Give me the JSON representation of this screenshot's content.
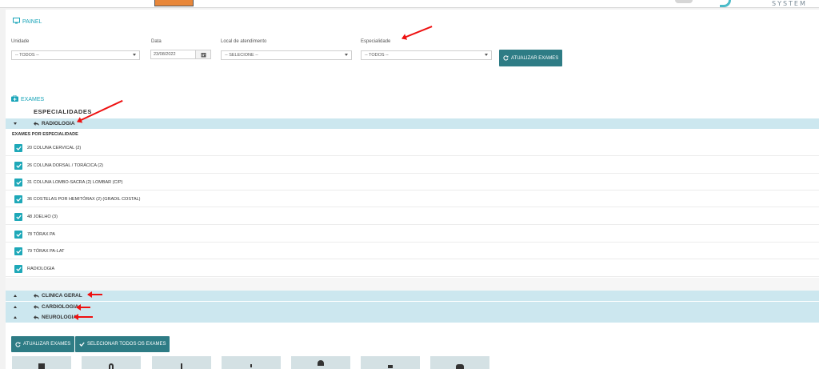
{
  "header": {
    "logo_text": "SYSTEM"
  },
  "painel": {
    "title": "PAINEL",
    "unidade_label": "Unidade",
    "unidade_value": "-- TODOS --",
    "data_label": "Data",
    "data_value": "23/08/2022",
    "local_label": "Local de atendimento",
    "local_value": "-- SELECIONE --",
    "especialidade_label": "Especialidade",
    "especialidade_value": "-- TODOS --",
    "update_button": "ATUALIZAR EXAMES"
  },
  "exames": {
    "title": "EXAMES",
    "especialidades_heading": "ESPECIALIDADES",
    "group_open": "RADIOLOGIA",
    "subheading": "EXAMES POR ESPECIALIDADE",
    "items": [
      "20 COLUNA CERVICAL (2)",
      "26 COLUNA DORSAL / TORÁCICA (2)",
      "31 COLUNA LOMBO-SACRA (2) LOMBAR (C/P)",
      "36 COSTELAS POR HEMITÓRAX (2) (GRADIL COSTAL)",
      "48 JOELHO (3)",
      "78 TÓRAX PA",
      "79 TÓRAX PA-LAT",
      "RADIOLOGIA"
    ],
    "groups_collapsed": [
      "CLINICA GERAL",
      "CARDIOLOGIA",
      "NEUROLOGIA"
    ]
  },
  "footer": {
    "update_button": "ATUALIZAR EXAMES",
    "select_all_button": "SELECIONAR TODOS OS EXAMES"
  },
  "colors": {
    "accent": "#1aa5b9",
    "button": "#2e7c85",
    "accordion": "#cce7ef",
    "annotation": "#ee1111"
  }
}
